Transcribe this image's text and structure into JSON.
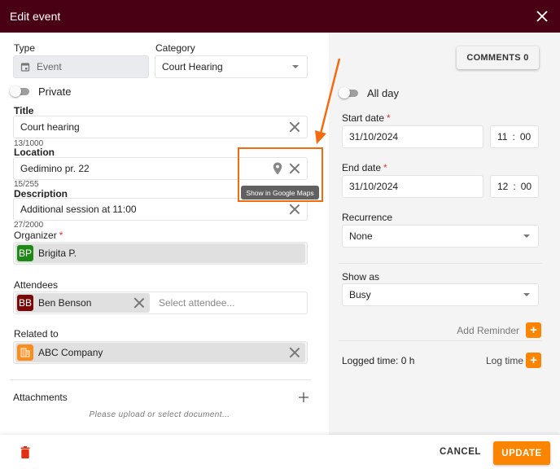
{
  "header": {
    "title": "Edit event"
  },
  "form": {
    "type": {
      "label": "Type",
      "value": "Event"
    },
    "category": {
      "label": "Category",
      "value": "Court Hearing"
    },
    "private": {
      "label": "Private",
      "on": false
    },
    "title": {
      "label": "Title",
      "value": "Court hearing",
      "counter": "13/1000"
    },
    "location": {
      "label": "Location",
      "value": "Gedimino pr. 22",
      "counter": "15/255",
      "tooltip": "Show in Google Maps"
    },
    "description": {
      "label": "Description",
      "value": "Additional session at 11:00",
      "counter": "27/2000"
    },
    "organizer": {
      "label": "Organizer",
      "required_mark": "*",
      "initials": "BP",
      "name": "Brigita P.",
      "avatar_color": "#1e8a16"
    },
    "attendees": {
      "label": "Attendees",
      "chips": [
        {
          "initials": "BB",
          "name": "Ben Benson",
          "avatar_color": "#7a0a0a"
        }
      ],
      "placeholder": "Select attendee..."
    },
    "related_to": {
      "label": "Related to",
      "name": "ABC Company",
      "icon_color": "#fb8c1e"
    },
    "attachments": {
      "label": "Attachments",
      "empty_text": "Please upload or select document..."
    }
  },
  "side": {
    "comments_button": "COMMENTS 0",
    "all_day": {
      "label": "All day",
      "on": false
    },
    "start_date": {
      "label": "Start date",
      "required_mark": "*",
      "date": "31/10/2024",
      "hour": "11",
      "minute": "00"
    },
    "end_date": {
      "label": "End date",
      "required_mark": "*",
      "date": "31/10/2024",
      "hour": "12",
      "minute": "00"
    },
    "recurrence": {
      "label": "Recurrence",
      "value": "None"
    },
    "show_as": {
      "label": "Show as",
      "value": "Busy"
    },
    "add_reminder": "Add Reminder",
    "logged_time": "Logged time: 0 h",
    "log_time": "Log time"
  },
  "footer": {
    "cancel": "CANCEL",
    "update": "UPDATE"
  },
  "colors": {
    "header_bg": "#4a0014",
    "accent": "#fb8500",
    "annotation": "#f26b0f",
    "delete": "#e03010"
  }
}
